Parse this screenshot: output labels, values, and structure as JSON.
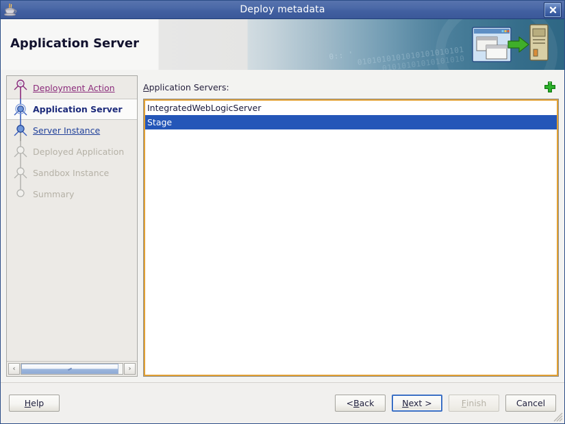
{
  "window": {
    "title": "Deploy metadata",
    "icon": "java-coffee-cup-icon",
    "close_label": "×"
  },
  "banner": {
    "title": "Application Server",
    "icon": "deploy-to-server-icon",
    "bits_line1": "0101010101010101010101",
    "bits_line2": "01010101010101010",
    "bits_line3": "0:: '"
  },
  "sidebar": {
    "steps": [
      {
        "label": "Deployment Action",
        "state": "done"
      },
      {
        "label": "Application Server",
        "state": "current"
      },
      {
        "label": "Server Instance",
        "state": "link"
      },
      {
        "label": "Deployed Application",
        "state": "disabled"
      },
      {
        "label": "Sandbox Instance",
        "state": "disabled"
      },
      {
        "label": "Summary",
        "state": "disabled"
      }
    ],
    "scroll": {
      "left_arrow": "‹",
      "right_arrow": "›"
    }
  },
  "main": {
    "list_label_mnemonic": "A",
    "list_label_rest": "pplication Servers:",
    "add_button": "add-icon",
    "servers": [
      {
        "name": "IntegratedWebLogicServer",
        "selected": false
      },
      {
        "name": "Stage",
        "selected": true
      }
    ]
  },
  "footer": {
    "help": {
      "mnemonic": "H",
      "rest": "elp"
    },
    "back": {
      "pre": "< ",
      "mnemonic": "B",
      "rest": "ack"
    },
    "next": {
      "mnemonic": "N",
      "rest": "ext >"
    },
    "finish": {
      "mnemonic": "F",
      "rest": "inish",
      "disabled": true
    },
    "cancel": {
      "label": "Cancel"
    }
  },
  "colors": {
    "titlebar": "#4b69a7",
    "selection": "#2456b8",
    "focus_border": "#e2a033",
    "link": "#20409a",
    "visited_link": "#8a2a7a",
    "current_step": "#1c2a7a",
    "add_icon": "#2cb22c"
  }
}
